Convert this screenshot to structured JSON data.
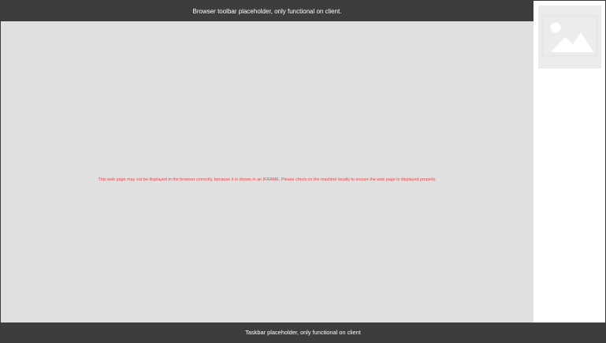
{
  "browser_toolbar": {
    "label": "Browser toolbar placeholder, only functional on client."
  },
  "viewport": {
    "warning": "This web page may not be displayed in the browser correctly, because it is shown in an IFRAME. Please check on the machine locally to ensure the web page is displayed properly.",
    "warning_color": "#ee4444"
  },
  "sidebar": {
    "thumbnail_icon": "image-placeholder-icon"
  },
  "taskbar": {
    "label": "Taskbar placeholder, only functional on client"
  }
}
